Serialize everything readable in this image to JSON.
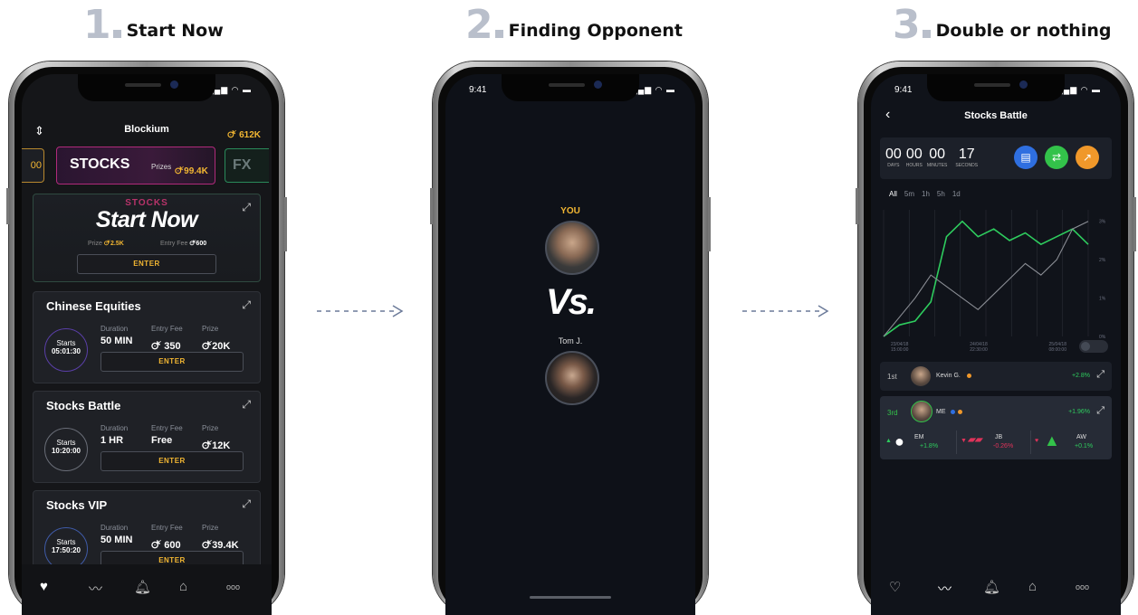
{
  "steps": [
    {
      "num": "1",
      "label": "Start Now"
    },
    {
      "num": "2",
      "label": "Finding Opponent"
    },
    {
      "num": "3",
      "label": "Double or nothing"
    }
  ],
  "phone1": {
    "brand": "Blockium",
    "coins": "612K",
    "carousel": {
      "left_value": "00",
      "center": "STOCKS",
      "prizes_label": "Prizes",
      "prizes_value": "99.4K",
      "right": "FX"
    },
    "hero": {
      "overline": "STOCKS",
      "title": "Start Now",
      "prize_label": "Prize",
      "prize_value": "2.5K",
      "fee_label": "Entry Fee",
      "fee_value": "600",
      "button": "ENTER"
    },
    "cards": [
      {
        "title": "Chinese Equities",
        "starts_label": "Starts",
        "starts_time": "05:01:30",
        "duration_label": "Duration",
        "duration": "50 MIN",
        "fee_label": "Entry Fee",
        "fee": "350",
        "prize_label": "Prize",
        "prize": "20K",
        "button": "ENTER"
      },
      {
        "title": "Stocks Battle",
        "starts_label": "Starts",
        "starts_time": "10:20:00",
        "duration_label": "Duration",
        "duration": "1 HR",
        "fee_label": "Entry Fee",
        "fee": "Free",
        "prize_label": "Prize",
        "prize": "12K",
        "button": "ENTER"
      },
      {
        "title": "Stocks VIP",
        "starts_label": "Starts",
        "starts_time": "17:50:20",
        "duration_label": "Duration",
        "duration": "50 MIN",
        "fee_label": "Entry Fee",
        "fee": "600",
        "prize_label": "Prize",
        "prize": "39.4K",
        "button": "ENTER"
      }
    ],
    "tabs": [
      "home-icon",
      "chart-icon",
      "bell-icon",
      "shop-icon",
      "more-icon"
    ],
    "more": "ooo"
  },
  "phone2": {
    "time": "9:41",
    "you_label": "YOU",
    "vs": "Vs.",
    "opponent": "Tom J."
  },
  "phone3": {
    "time": "9:41",
    "title": "Stocks Battle",
    "countdown": [
      {
        "value": "00",
        "unit": "DAYS"
      },
      {
        "value": "00",
        "unit": "HOURS"
      },
      {
        "value": "00",
        "unit": "MINUTES"
      },
      {
        "value": "17",
        "unit": "SECONDS"
      }
    ],
    "ranges": [
      "All",
      "5m",
      "1h",
      "5h",
      "1d"
    ],
    "y_ticks": [
      "3%",
      "2%",
      "1%",
      "0%"
    ],
    "x_ticks": [
      {
        "date": "23/04/18",
        "time": "15:00:00"
      },
      {
        "date": "24/04/18",
        "time": "22:30:00"
      },
      {
        "date": "25/04/18",
        "time": "08:00:00"
      }
    ],
    "series": [
      {
        "color": "#2ecc5e",
        "values": [
          0.0,
          0.3,
          0.4,
          0.9,
          2.6,
          3.0,
          2.6,
          2.8,
          2.5,
          2.7,
          2.4,
          2.6,
          2.8,
          2.4
        ]
      },
      {
        "color": "#8a8d94",
        "values": [
          0.0,
          0.5,
          1.0,
          1.6,
          1.3,
          1.0,
          0.7,
          1.1,
          1.5,
          1.9,
          1.6,
          2.0,
          2.8,
          3.0
        ]
      }
    ],
    "leader": {
      "rank": "1st",
      "name": "Kevin G.",
      "change": "+2.8%"
    },
    "me": {
      "rank": "3rd",
      "name": "ME",
      "change": "+1.96%"
    },
    "holdings": [
      {
        "ticker": "EM",
        "change": "+1.8%"
      },
      {
        "ticker": "JB",
        "change": "-0.26%"
      },
      {
        "ticker": "AW",
        "change": "+0.1%"
      }
    ],
    "more": "ooo"
  }
}
